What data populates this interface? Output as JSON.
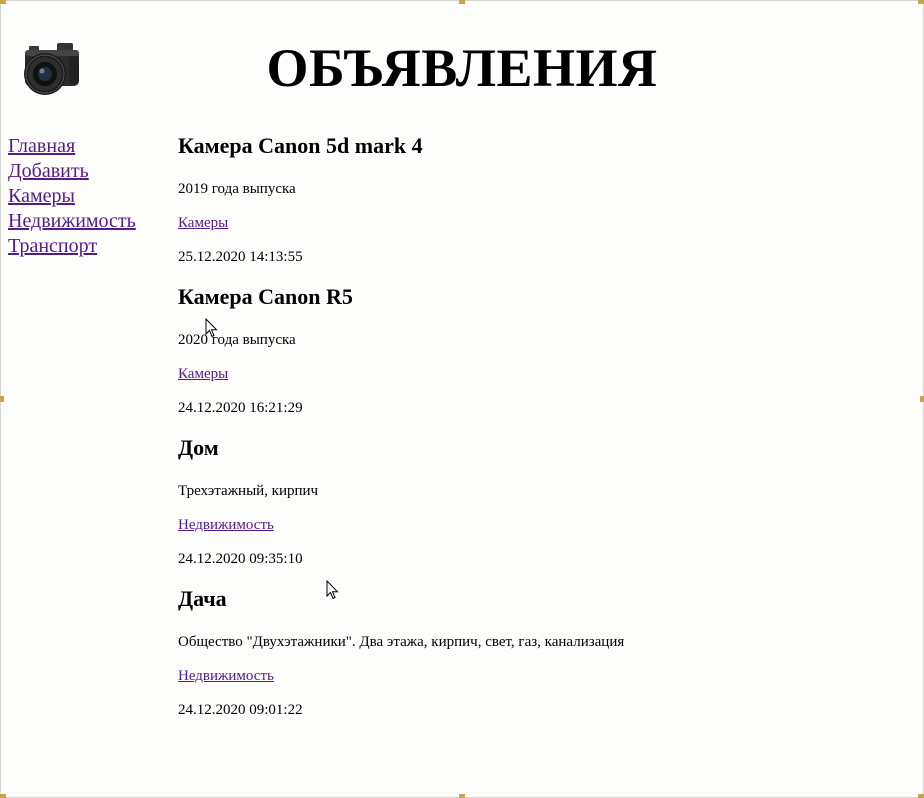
{
  "header": {
    "title": "ОБЪЯВЛЕНИЯ",
    "logo_icon": "camera-icon"
  },
  "sidebar": {
    "items": [
      {
        "label": "Главная"
      },
      {
        "label": "Добавить"
      },
      {
        "label": "Камеры"
      },
      {
        "label": "Недвижимость"
      },
      {
        "label": "Транспорт"
      }
    ]
  },
  "ads": [
    {
      "title": "Камера Canon 5d mark 4",
      "description": "2019 года выпуска",
      "category": "Камеры",
      "date": "25.12.2020 14:13:55"
    },
    {
      "title": "Камера Canon R5",
      "description": "2020 года выпуска",
      "category": "Камеры",
      "date": "24.12.2020 16:21:29"
    },
    {
      "title": "Дом",
      "description": "Трехэтажный, кирпич",
      "category": "Недвижимость",
      "date": "24.12.2020 09:35:10"
    },
    {
      "title": "Дача",
      "description": "Общество \"Двухэтажники\". Два этажа, кирпич, свет, газ, канализация",
      "category": "Недвижимость",
      "date": "24.12.2020 09:01:22"
    }
  ],
  "colors": {
    "link": "#551a8b",
    "background": "#fdfdfb"
  }
}
